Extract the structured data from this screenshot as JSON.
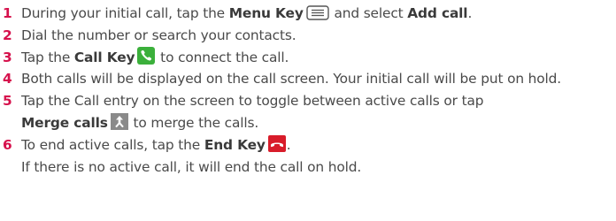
{
  "steps": [
    {
      "num": "1",
      "t1": "During your initial call, tap the ",
      "b1": "Menu Key",
      "icon": "menu-key-icon",
      "t2": " and select ",
      "b2": "Add call",
      "t3": "."
    },
    {
      "num": "2",
      "t1": "Dial the number or search your contacts."
    },
    {
      "num": "3",
      "t1": "Tap the ",
      "b1": "Call Key",
      "icon": "call-key-icon",
      "t2": " to connect the call."
    },
    {
      "num": "4",
      "t1": "Both calls will be displayed on the call screen. Your initial call will be put on hold."
    },
    {
      "num": "5",
      "t1": "Tap the Call entry on the screen to toggle between active calls or tap",
      "b1": "Merge calls",
      "icon": "merge-calls-icon",
      "t2": " to merge the calls."
    },
    {
      "num": "6",
      "t1": "To end active calls, tap the ",
      "b1": "End Key",
      "icon": "end-key-icon",
      "t2": ".",
      "t3": "If there is no active call, it will end the call on hold."
    }
  ],
  "colors": {
    "step_number": "#d6114c",
    "body_text": "#4a4a4a",
    "call_key_green": "#3bb03b",
    "end_key_red": "#d81c2a",
    "merge_icon_gray": "#8a8a8a"
  }
}
